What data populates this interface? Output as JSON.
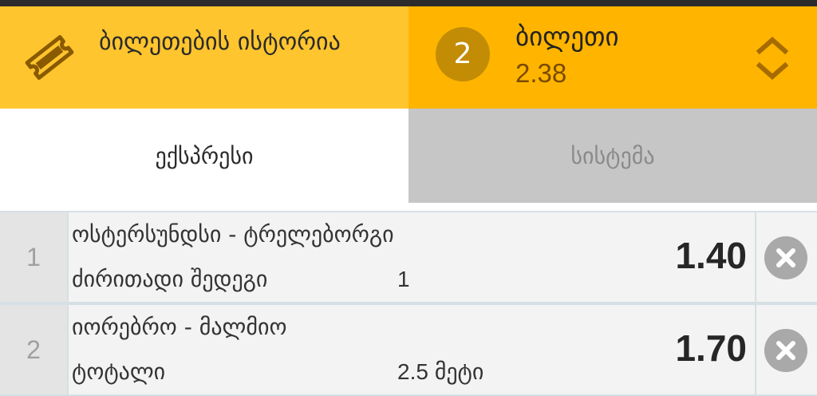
{
  "header": {
    "history_label": "ბილეთების ისტორია",
    "ticket_count": "2",
    "ticket_title": "ბილეთი",
    "ticket_odds": "2.38"
  },
  "tabs": [
    {
      "label": "ექსპრესი",
      "active": true
    },
    {
      "label": "სისტემა",
      "active": false
    }
  ],
  "bets": [
    {
      "index": "1",
      "match": "ოსტერსუნდსი - ტრელებორგი",
      "market": "ძირითადი შედეგი",
      "selection": "1",
      "odds": "1.40"
    },
    {
      "index": "2",
      "match": "იორებრო - მალმიო",
      "market": "ტოტალი",
      "selection": "2.5 მეტი",
      "odds": "1.70"
    }
  ],
  "colors": {
    "history_bg": "#ffc52e",
    "ticket_bg": "#ffb400",
    "count_circle": "#c38c05",
    "icon_brown": "#8a5a00",
    "inactive_tab": "#c6c6c6"
  },
  "icons": {
    "history": "ticket-icon",
    "toggle": "chevron-up-down-icon",
    "remove": "close-circle-icon"
  }
}
